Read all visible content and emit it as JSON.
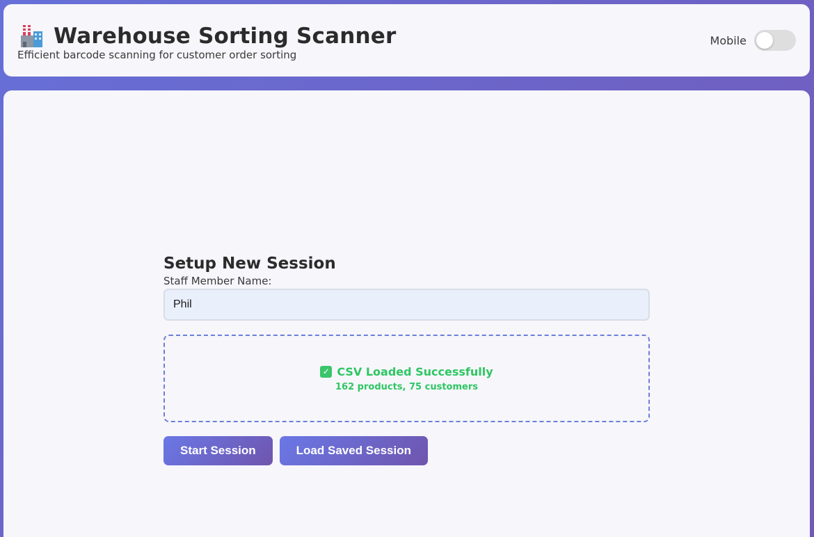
{
  "header": {
    "title": "Warehouse Sorting Scanner",
    "subtitle": "Efficient barcode scanning for customer order sorting",
    "icon": "factory-icon",
    "mobile_label": "Mobile",
    "mobile_toggle_on": false
  },
  "setup": {
    "title": "Setup New Session",
    "staff_label": "Staff Member Name:",
    "staff_value": "Phil",
    "csv_status": "CSV Loaded Successfully",
    "csv_detail": "162 products, 75 customers",
    "start_button": "Start Session",
    "load_button": "Load Saved Session"
  },
  "colors": {
    "accent_start": "#6a78e6",
    "accent_end": "#6f55ad",
    "success": "#2ec662"
  }
}
